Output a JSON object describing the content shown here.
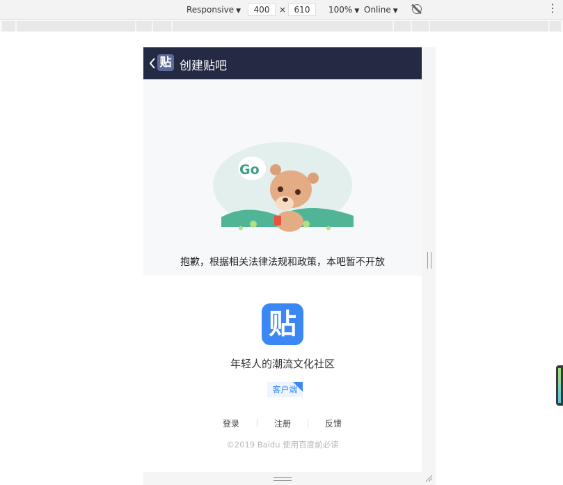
{
  "devtools": {
    "device": "Responsive",
    "width": "400",
    "times": "×",
    "height": "610",
    "zoom": "100%",
    "network": "Online",
    "rotate_icon": "rotate-icon",
    "menu_icon": "more-vert-icon"
  },
  "nav": {
    "logo_text": "贴",
    "title": "创建贴吧"
  },
  "hero": {
    "bubble_text": "Go",
    "message": "抱歉，根据相关法律法规和政策，本吧暂不开放"
  },
  "promo": {
    "app_icon_text": "贴",
    "slogan": "年轻人的潮流文化社区",
    "client_button": "客户端",
    "links": [
      "登录",
      "注册",
      "反馈"
    ],
    "copyright": "©2019 Baidu 使用百度前必读"
  },
  "colors": {
    "nav_bg": "#242a44",
    "brand_blue": "#3b88f5",
    "hero_bg": "#f7f8fa"
  }
}
